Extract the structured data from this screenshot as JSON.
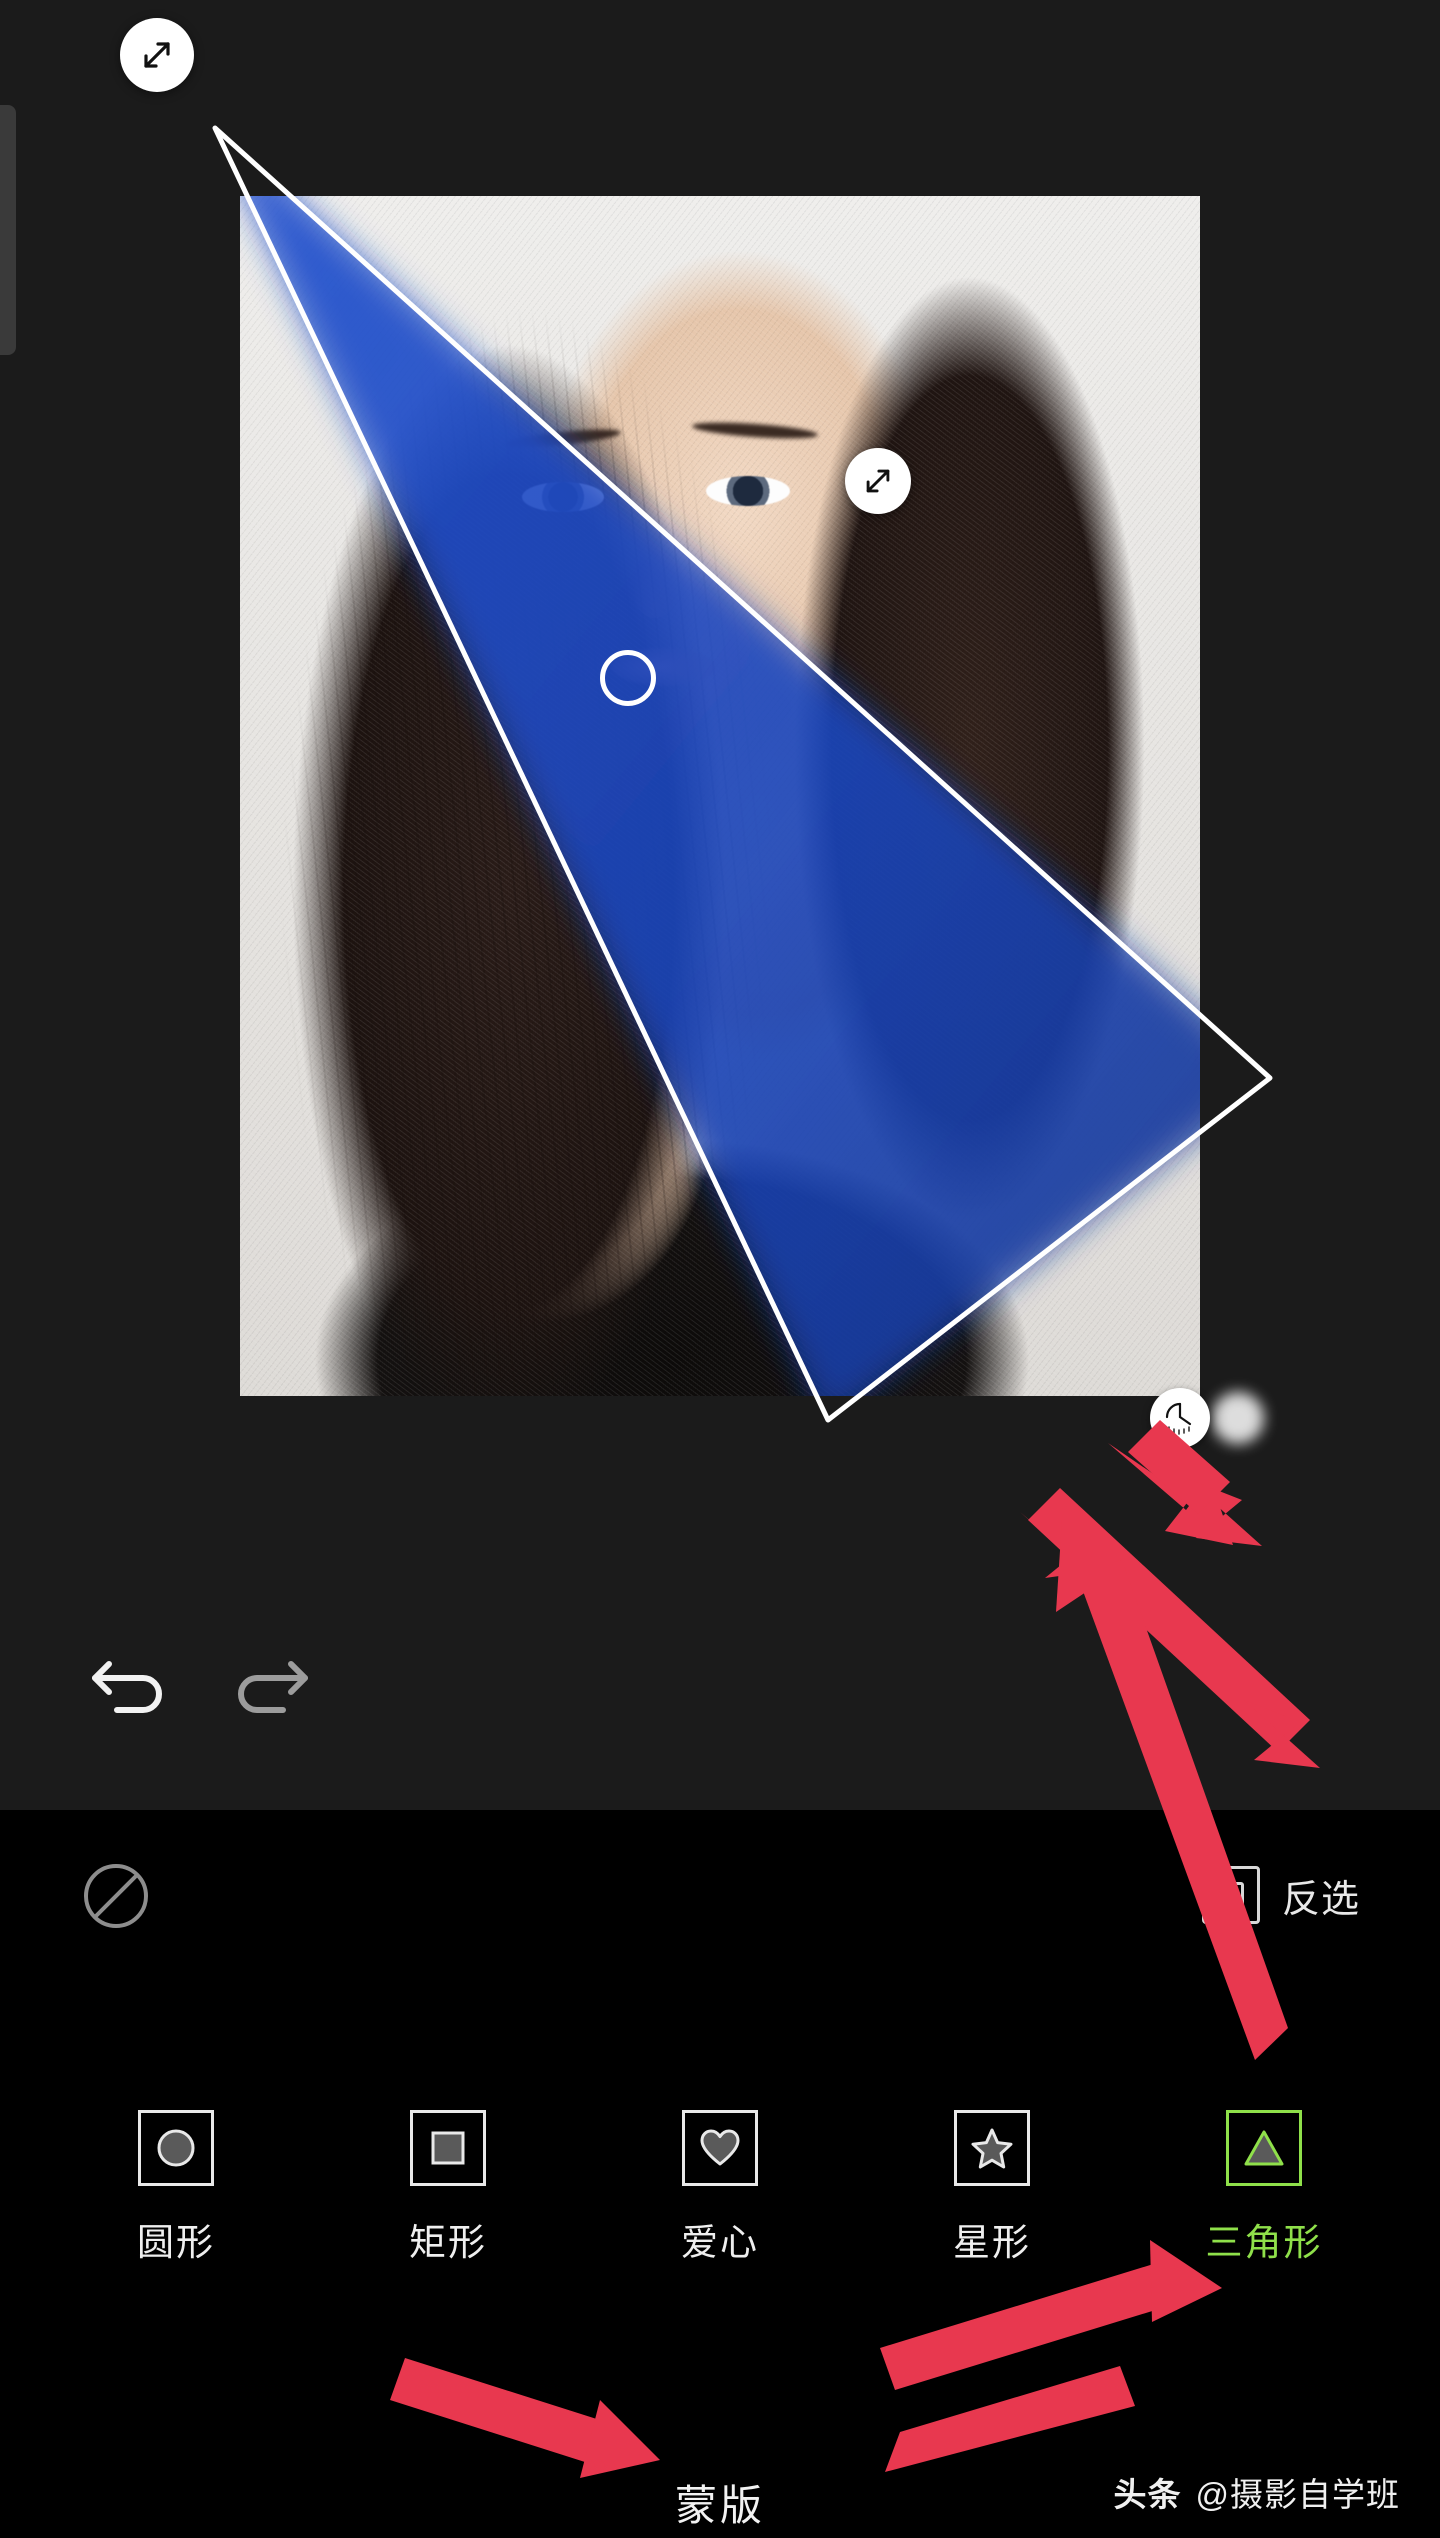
{
  "app": {
    "theme_background": "#000000",
    "stage_background": "#1b1b1b",
    "accent_color": "#8fe04a",
    "annotation_color": "#e8384f",
    "mask_overlay_color": "#1d4fc4"
  },
  "canvas": {
    "handles": [
      {
        "name": "resize-handle-top-left",
        "icon": "diagonal-resize-icon"
      },
      {
        "name": "resize-handle-middle",
        "icon": "diagonal-resize-icon"
      },
      {
        "name": "center-move-handle",
        "icon": "circle-outline-icon"
      }
    ],
    "feather_slider": {
      "name": "feather-blur-slider",
      "icon": "feather-knob-icon"
    }
  },
  "history": {
    "undo_label": "undo-icon",
    "redo_label": "redo-icon"
  },
  "tools": {
    "none_icon_label": "no-mask-icon",
    "invert": {
      "label": "反选",
      "icon": "invert-selection-icon"
    },
    "shapes_title": "蒙版",
    "shapes": [
      {
        "icon": "circle-shape-icon",
        "label": "圆形",
        "selected": false
      },
      {
        "icon": "rectangle-shape-icon",
        "label": "矩形",
        "selected": false
      },
      {
        "icon": "heart-shape-icon",
        "label": "爱心",
        "selected": false
      },
      {
        "icon": "star-shape-icon",
        "label": "星形",
        "selected": false
      },
      {
        "icon": "triangle-shape-icon",
        "label": "三角形",
        "selected": true
      }
    ]
  },
  "watermark": {
    "logo": "头条",
    "handle": "@摄影自学班"
  }
}
